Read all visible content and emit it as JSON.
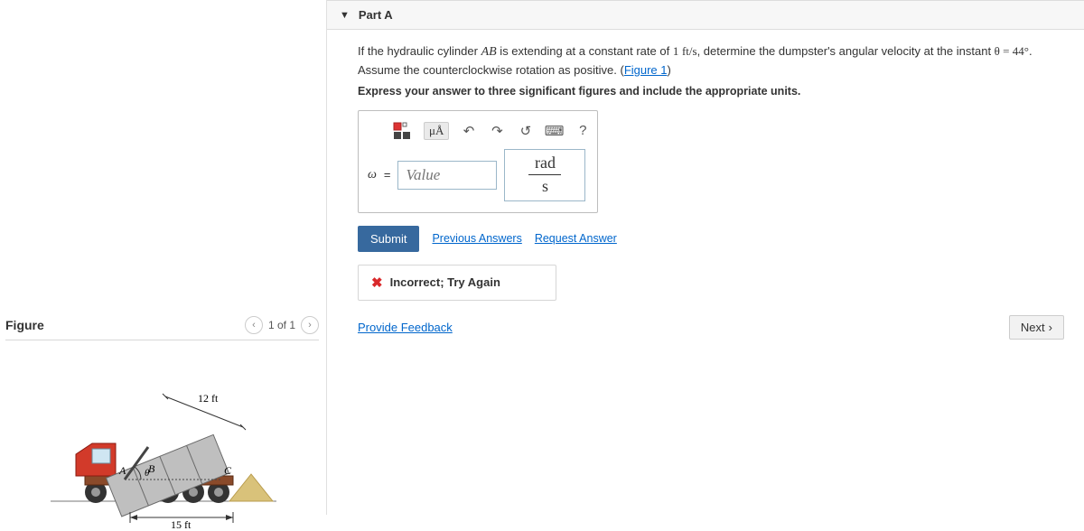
{
  "part": {
    "header_label": "Part A",
    "prompt_pre": "If the hydraulic cylinder ",
    "prompt_ab": "AB",
    "prompt_mid1": " is extending at a constant rate of ",
    "rate_val": "1",
    "rate_unit": "ft/s",
    "prompt_mid2": ", determine the dumpster's angular velocity at the instant ",
    "theta_eq": "θ = 44°",
    "prompt_mid3": ". Assume the counterclockwise rotation as positive. (",
    "figure_link": "Figure 1",
    "prompt_end": ")",
    "instruct": "Express your answer to three significant figures and include the appropriate units."
  },
  "toolbar": {
    "mu_a": "μÅ",
    "help": "?"
  },
  "answer": {
    "var": "ω",
    "eq": "=",
    "placeholder": "Value",
    "unit_num": "rad",
    "unit_den": "s"
  },
  "actions": {
    "submit": "Submit",
    "prev_answers": "Previous Answers",
    "request": "Request Answer"
  },
  "feedback": {
    "text": "Incorrect; Try Again"
  },
  "footer": {
    "provide": "Provide Feedback",
    "next": "Next"
  },
  "figure": {
    "title": "Figure",
    "pager": "1 of 1",
    "dim_top": "12 ft",
    "dim_bottom": "15 ft",
    "label_a": "A",
    "label_b": "B",
    "label_c": "C",
    "theta": "θ"
  }
}
